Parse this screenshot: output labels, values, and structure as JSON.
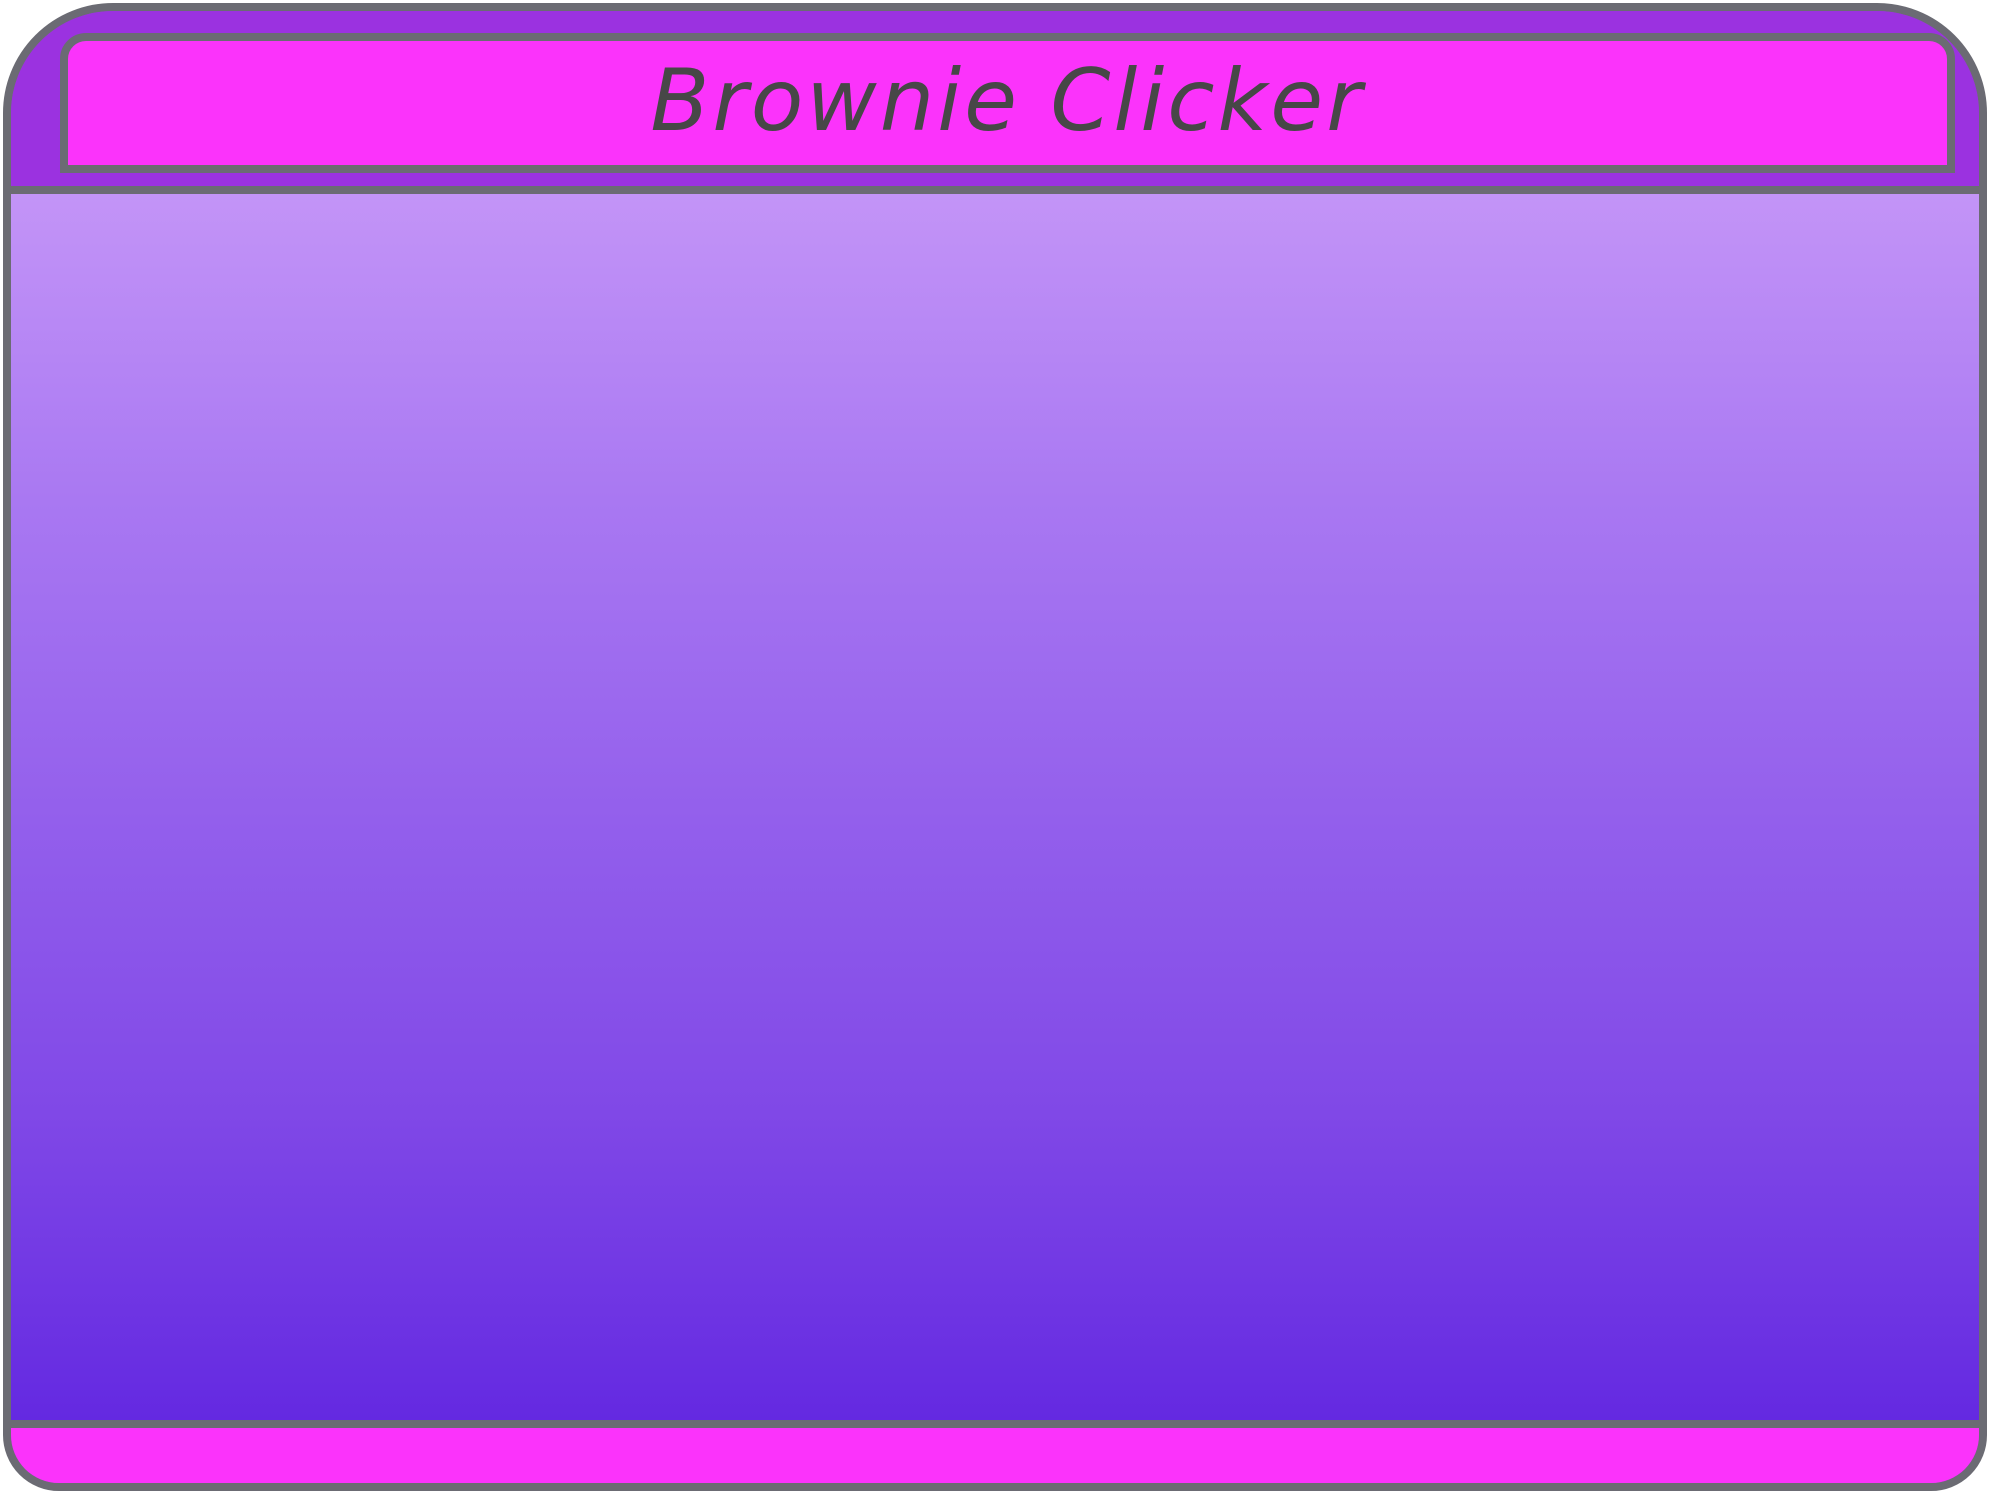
{
  "app": {
    "title": "Brownie Clicker"
  },
  "colors": {
    "frame_border": "#6b6b73",
    "header_background": "#9b32e0",
    "title_box_background": "#fb33fb",
    "title_text": "#474747",
    "play_area_gradient_top": "#c394f7",
    "play_area_gradient_bottom": "#6429e1",
    "footer_background": "#fb33fb"
  }
}
